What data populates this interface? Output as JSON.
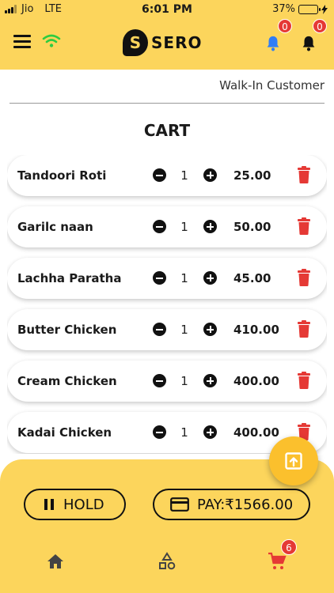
{
  "status": {
    "carrier": "Jio",
    "network": "LTE",
    "time": "6:01 PM",
    "battery_text": "37%",
    "battery_level": 0.37
  },
  "header": {
    "logo_mark": "S",
    "logo_text": "SERO",
    "notification_count": "0",
    "alert_count": "0"
  },
  "customer": "Walk-In Customer",
  "cart": {
    "title": "CART",
    "items": [
      {
        "name": "Tandoori Roti",
        "qty": "1",
        "price": "25.00"
      },
      {
        "name": "Garilc naan",
        "qty": "1",
        "price": "50.00"
      },
      {
        "name": "Lachha Paratha",
        "qty": "1",
        "price": "45.00"
      },
      {
        "name": "Butter Chicken",
        "qty": "1",
        "price": "410.00"
      },
      {
        "name": "Cream Chicken",
        "qty": "1",
        "price": "400.00"
      },
      {
        "name": "Kadai Chicken",
        "qty": "1",
        "price": "400.00"
      }
    ]
  },
  "actions": {
    "hold_label": "HOLD",
    "pay_label": "PAY:₹1566.00"
  },
  "nav": {
    "cart_count": "6"
  },
  "colors": {
    "accent": "#fcd55c",
    "fab": "#fbc02d",
    "delete": "#e53935",
    "bell_blue": "#2f7df6",
    "wifi_green": "#2ecc40"
  }
}
